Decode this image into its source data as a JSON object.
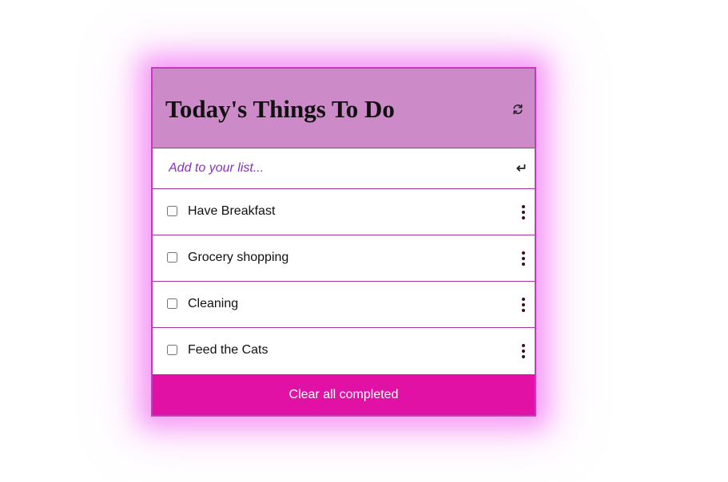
{
  "header": {
    "title": "Today's Things To Do",
    "refresh_icon": "refresh-icon"
  },
  "add": {
    "placeholder": "Add to your list...",
    "submit_icon": "enter-icon"
  },
  "items": [
    {
      "label": "Have Breakfast",
      "checked": false
    },
    {
      "label": "Grocery shopping",
      "checked": false
    },
    {
      "label": "Cleaning",
      "checked": false
    },
    {
      "label": "Feed the Cats",
      "checked": false
    }
  ],
  "footer": {
    "clear_label": "Clear all completed"
  },
  "colors": {
    "header_bg": "#cd8ac8",
    "border": "#c43ac0",
    "accent": "#e111a6",
    "placeholder": "#8a2fc0",
    "glow": "#ee58ee"
  }
}
